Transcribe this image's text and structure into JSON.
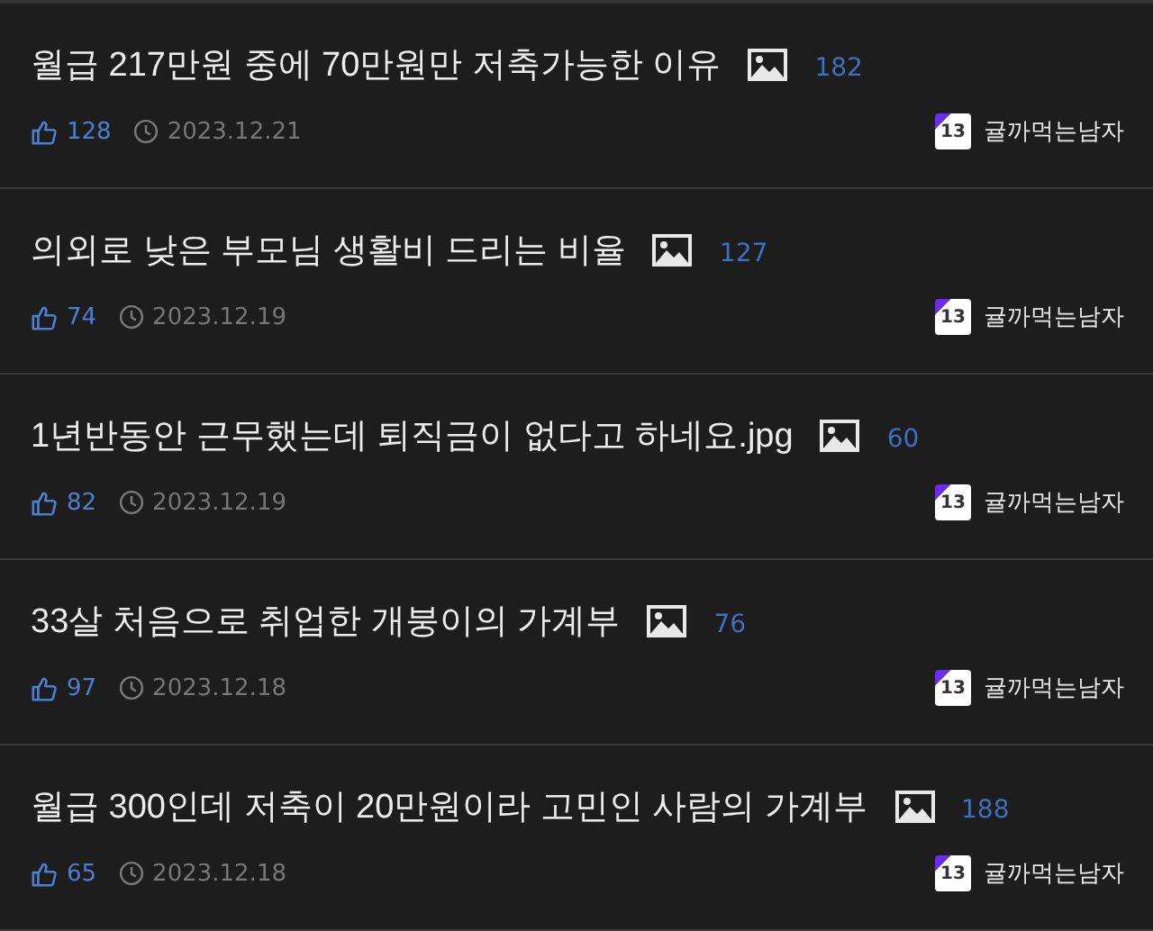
{
  "posts": [
    {
      "title": "월급 217만원 중에 70만원만 저축가능한 이유",
      "has_image": true,
      "views": "182",
      "likes": "128",
      "date": "2023.12.21",
      "author_level": "13",
      "author": "귤까먹는남자"
    },
    {
      "title": "의외로 낮은 부모님 생활비 드리는 비율",
      "has_image": true,
      "views": "127",
      "likes": "74",
      "date": "2023.12.19",
      "author_level": "13",
      "author": "귤까먹는남자"
    },
    {
      "title": "1년반동안 근무했는데 퇴직금이 없다고 하네요.jpg",
      "has_image": true,
      "views": "60",
      "likes": "82",
      "date": "2023.12.19",
      "author_level": "13",
      "author": "귤까먹는남자"
    },
    {
      "title": "33살 처음으로 취업한 개붕이의 가계부",
      "has_image": true,
      "views": "76",
      "likes": "97",
      "date": "2023.12.18",
      "author_level": "13",
      "author": "귤까먹는남자"
    },
    {
      "title": "월급 300인데 저축이 20만원이라 고민인 사람의 가계부",
      "has_image": true,
      "views": "188",
      "likes": "65",
      "date": "2023.12.18",
      "author_level": "13",
      "author": "귤까먹는남자"
    }
  ]
}
